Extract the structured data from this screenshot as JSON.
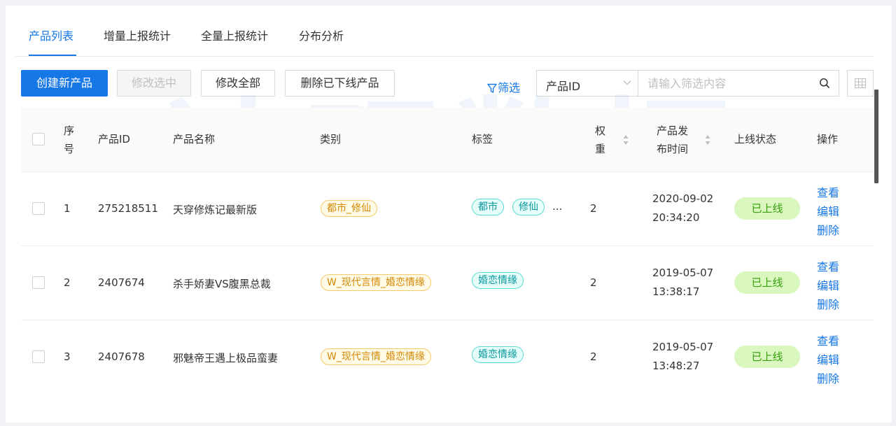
{
  "tabs": [
    {
      "label": "产品列表",
      "active": true
    },
    {
      "label": "增量上报统计",
      "active": false
    },
    {
      "label": "全量上报统计",
      "active": false
    },
    {
      "label": "分布分析",
      "active": false
    }
  ],
  "toolbar": {
    "create_label": "创建新产品",
    "edit_selected_label": "修改选中",
    "edit_all_label": "修改全部",
    "delete_offline_label": "删除已下线产品",
    "filter_label": "筛选",
    "filter_field": "产品ID",
    "search_placeholder": "请输入筛选内容",
    "search_value": ""
  },
  "table": {
    "headers": {
      "index_line1": "序",
      "index_line2": "号",
      "product_id": "产品ID",
      "product_name": "产品名称",
      "category": "类别",
      "tags": "标签",
      "weight_line1": "权",
      "weight_line2": "重",
      "publish_line1": "产品发",
      "publish_line2": "布时间",
      "status": "上线状态",
      "actions": "操作"
    },
    "rows": [
      {
        "index": "1",
        "product_id": "275218511",
        "product_name": "天穿修炼记最新版",
        "category": "都市_修仙",
        "tags": [
          "都市",
          "修仙"
        ],
        "more": "...",
        "weight": "2",
        "publish_date": "2020-09-02",
        "publish_time": "20:34:20",
        "status": "已上线",
        "view": "查看",
        "edit": "编辑",
        "delete": "删除"
      },
      {
        "index": "2",
        "product_id": "2407674",
        "product_name": "杀手娇妻VS腹黑总裁",
        "category": "W_现代言情_婚恋情缘",
        "tags": [
          "婚恋情缘"
        ],
        "weight": "2",
        "publish_date": "2019-05-07",
        "publish_time": "13:38:17",
        "status": "已上线",
        "view": "查看",
        "edit": "编辑",
        "delete": "删除"
      },
      {
        "index": "3",
        "product_id": "2407678",
        "product_name": "邪魅帝王遇上极品蛮妻",
        "category": "W_现代言情_婚恋情缘",
        "tags": [
          "婚恋情缘"
        ],
        "weight": "2",
        "publish_date": "2019-05-07",
        "publish_time": "13:48:27",
        "status": "已上线",
        "view": "查看",
        "edit": "编辑",
        "delete": "删除"
      }
    ]
  },
  "watermark": {
    "cn": "达观数据",
    "en": "DATA GRAND"
  },
  "colors": {
    "accent": "#1677e6",
    "status_bg": "#d9f7be",
    "status_text": "#389e0d"
  }
}
